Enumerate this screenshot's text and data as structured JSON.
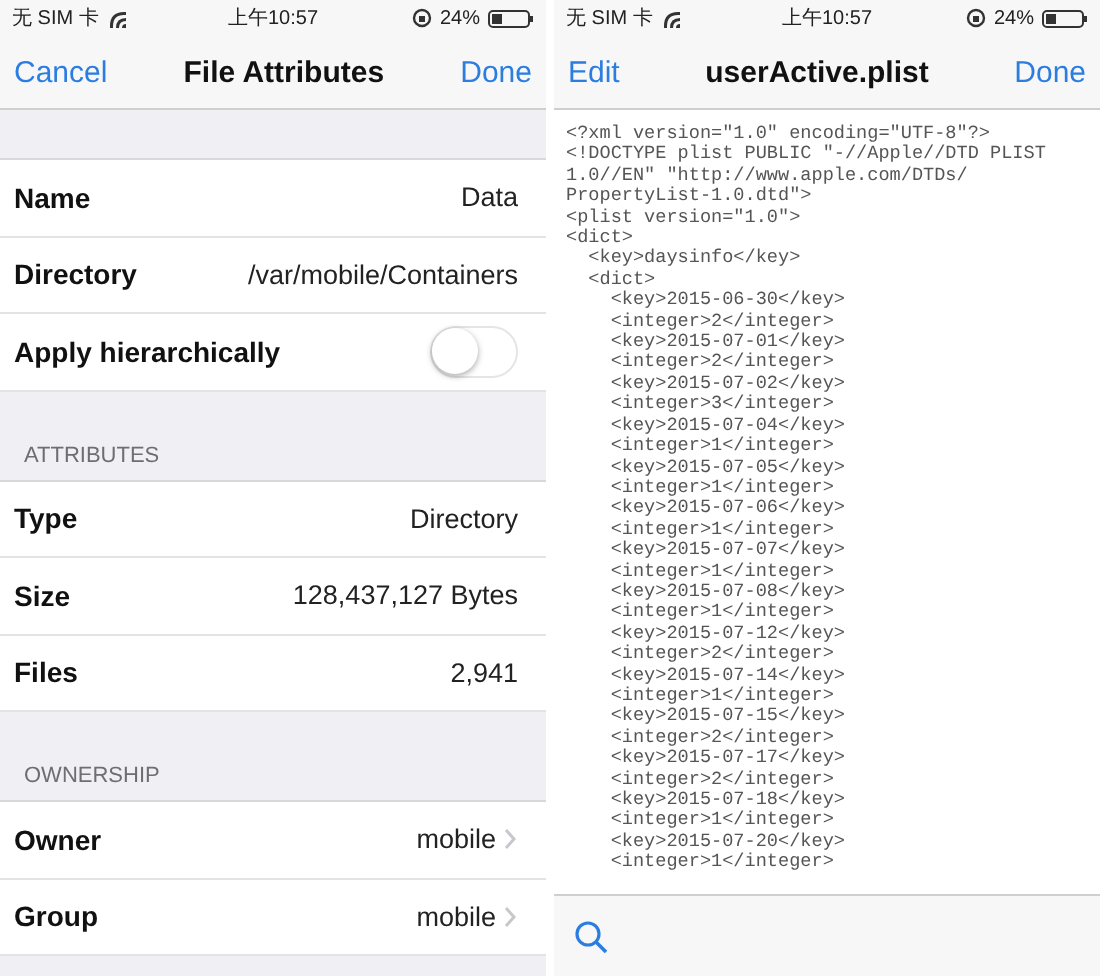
{
  "screens": [
    {
      "status_bar": {
        "carrier": "无 SIM 卡",
        "time": "上午10:57",
        "battery": "24%"
      },
      "nav": {
        "left": "Cancel",
        "title": "File Attributes",
        "right": "Done"
      },
      "sections": [
        {
          "rows": [
            {
              "kind": "value",
              "label": "Name",
              "value": "Data",
              "disclosure": false
            },
            {
              "kind": "value",
              "label": "Directory",
              "value": "/var/mobile/Containers",
              "disclosure": false
            },
            {
              "kind": "switch",
              "label": "Apply hierarchically",
              "on": false
            }
          ]
        },
        {
          "header": "ATTRIBUTES",
          "rows": [
            {
              "kind": "value",
              "label": "Type",
              "value": "Directory",
              "disclosure": false
            },
            {
              "kind": "value",
              "label": "Size",
              "value": "128,437,127 Bytes",
              "disclosure": false
            },
            {
              "kind": "value",
              "label": "Files",
              "value": "2,941",
              "disclosure": false
            }
          ]
        },
        {
          "header": "OWNERSHIP",
          "rows": [
            {
              "kind": "value",
              "label": "Owner",
              "value": "mobile",
              "disclosure": true
            },
            {
              "kind": "value",
              "label": "Group",
              "value": "mobile",
              "disclosure": true
            }
          ]
        }
      ]
    },
    {
      "status_bar": {
        "carrier": "无 SIM 卡",
        "time": "上午10:57",
        "battery": "24%"
      },
      "nav": {
        "left": "Edit",
        "title": "userActive.plist",
        "right": "Done"
      },
      "code_lines": [
        "<?xml version=\"1.0\" encoding=\"UTF-8\"?>",
        "<!DOCTYPE plist PUBLIC \"-//Apple//DTD PLIST",
        "1.0//EN\" \"http://www.apple.com/DTDs/",
        "PropertyList-1.0.dtd\">",
        "<plist version=\"1.0\">",
        "<dict>",
        "  <key>daysinfo</key>",
        "  <dict>",
        "    <key>2015-06-30</key>",
        "    <integer>2</integer>",
        "    <key>2015-07-01</key>",
        "    <integer>2</integer>",
        "    <key>2015-07-02</key>",
        "    <integer>3</integer>",
        "    <key>2015-07-04</key>",
        "    <integer>1</integer>",
        "    <key>2015-07-05</key>",
        "    <integer>1</integer>",
        "    <key>2015-07-06</key>",
        "    <integer>1</integer>",
        "    <key>2015-07-07</key>",
        "    <integer>1</integer>",
        "    <key>2015-07-08</key>",
        "    <integer>1</integer>",
        "    <key>2015-07-12</key>",
        "    <integer>2</integer>",
        "    <key>2015-07-14</key>",
        "    <integer>1</integer>",
        "    <key>2015-07-15</key>",
        "    <integer>2</integer>",
        "    <key>2015-07-17</key>",
        "    <integer>2</integer>",
        "    <key>2015-07-18</key>",
        "    <integer>1</integer>",
        "    <key>2015-07-20</key>",
        "    <integer>1</integer>"
      ]
    }
  ]
}
